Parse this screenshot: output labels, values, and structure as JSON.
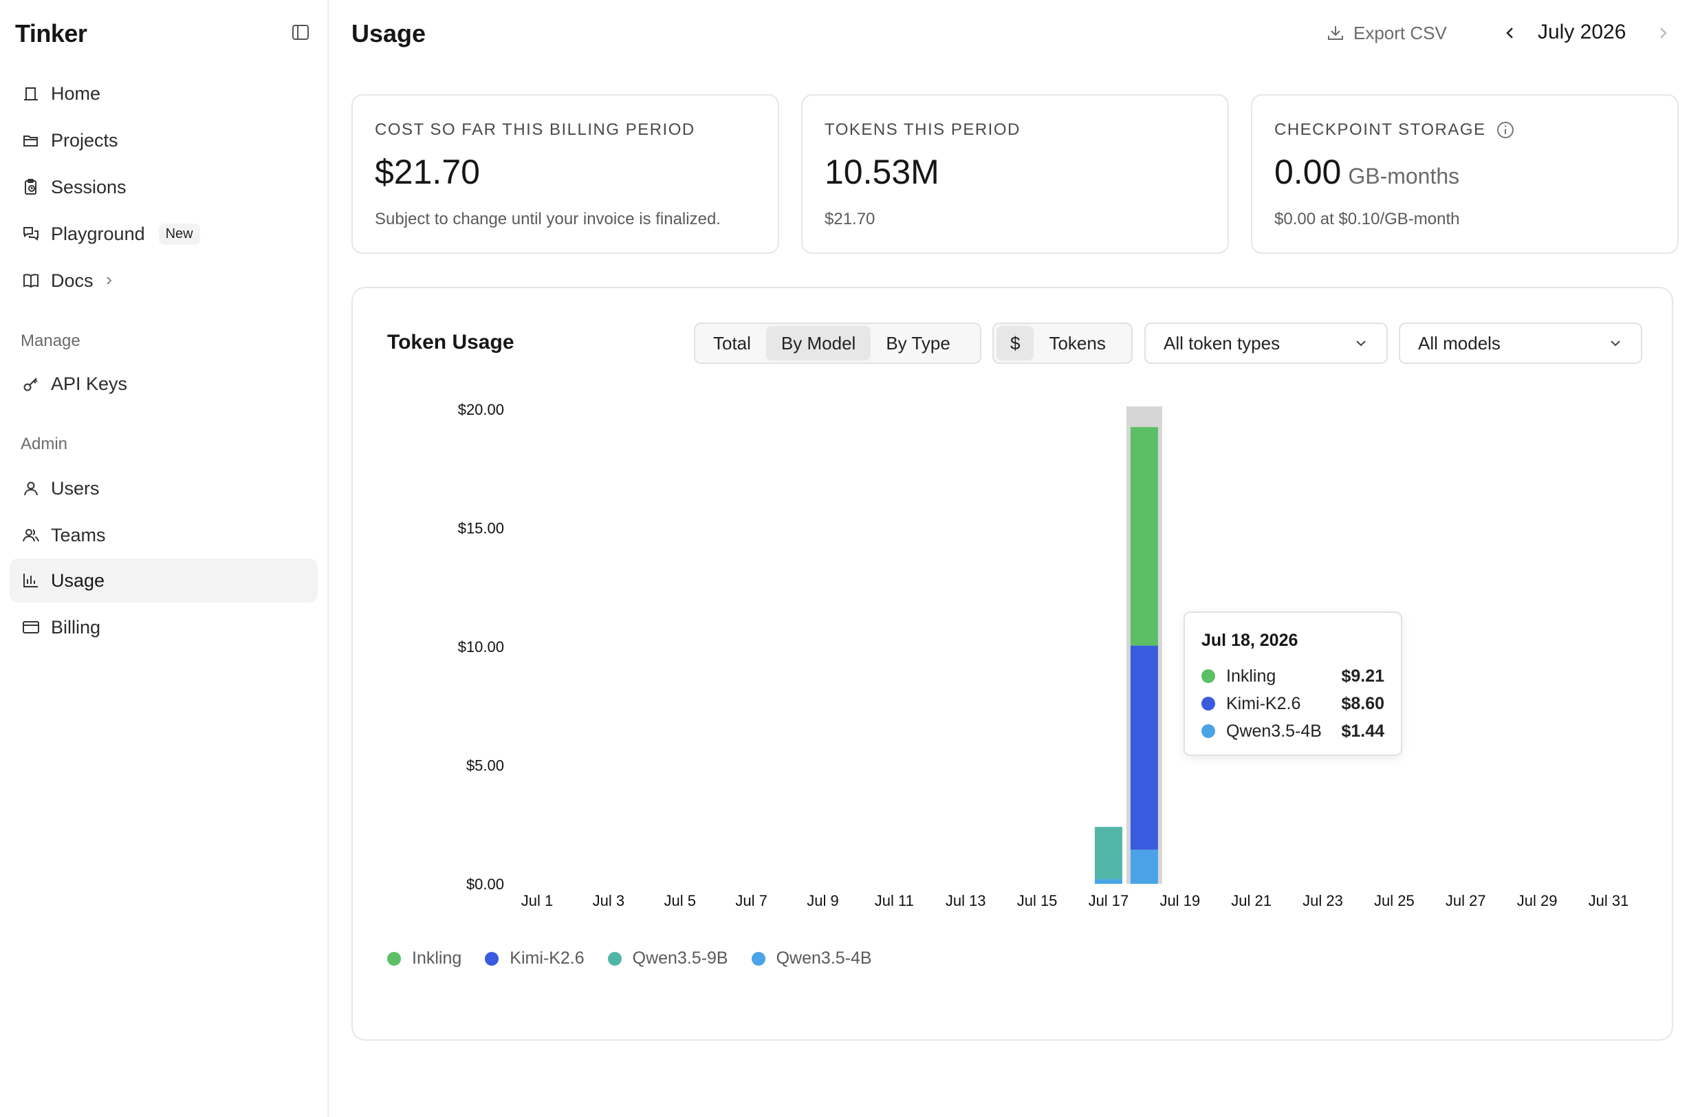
{
  "app": {
    "name": "Tinker"
  },
  "sidebar": {
    "items": [
      {
        "id": "home",
        "label": "Home",
        "icon": "home-icon"
      },
      {
        "id": "projects",
        "label": "Projects",
        "icon": "folder-icon"
      },
      {
        "id": "sessions",
        "label": "Sessions",
        "icon": "clipboard-clock-icon"
      },
      {
        "id": "playground",
        "label": "Playground",
        "icon": "chat-bubbles-icon",
        "badge": "New"
      },
      {
        "id": "docs",
        "label": "Docs",
        "icon": "book-open-icon"
      }
    ],
    "manage_label": "Manage",
    "manage_items": [
      {
        "id": "api-keys",
        "label": "API Keys",
        "icon": "key-icon"
      }
    ],
    "admin_label": "Admin",
    "admin_items": [
      {
        "id": "users",
        "label": "Users",
        "icon": "user-icon"
      },
      {
        "id": "teams",
        "label": "Teams",
        "icon": "users-icon"
      },
      {
        "id": "usage",
        "label": "Usage",
        "icon": "bar-chart-icon",
        "active": true
      },
      {
        "id": "billing",
        "label": "Billing",
        "icon": "credit-card-icon"
      }
    ]
  },
  "header": {
    "title": "Usage",
    "export_label": "Export CSV",
    "month": "July 2026"
  },
  "cards": [
    {
      "label": "COST SO FAR THIS BILLING PERIOD",
      "value": "$21.70",
      "sub": "Subject to change until your invoice is finalized."
    },
    {
      "label": "TOKENS THIS PERIOD",
      "value": "10.53M",
      "sub": "$21.70"
    },
    {
      "label": "CHECKPOINT STORAGE",
      "value": "0.00",
      "unit": "GB-months",
      "sub": "$0.00 at $0.10/GB-month"
    }
  ],
  "panel": {
    "title": "Token Usage",
    "view_tabs": [
      "Total",
      "By Model",
      "By Type"
    ],
    "view_selected": "By Model",
    "metric_tabs": [
      "$",
      "Tokens"
    ],
    "metric_selected": "$",
    "token_type_filter": "All token types",
    "model_filter": "All models"
  },
  "colors": {
    "Inkling": "#5cbf66",
    "Kimi-K2.6": "#3a5bde",
    "Qwen3.5-9B": "#52b6a6",
    "Qwen3.5-4B": "#4aa3e6",
    "hover_band": "#d6d6d6"
  },
  "chart_data": {
    "type": "bar",
    "stacked": true,
    "y_tick_labels": [
      "$0.00",
      "$5.00",
      "$10.00",
      "$15.00",
      "$20.00"
    ],
    "y_ticks": [
      0,
      5,
      10,
      15,
      20
    ],
    "ylim": [
      0,
      20
    ],
    "x_tick_labels": [
      "Jul 1",
      "Jul 3",
      "Jul 5",
      "Jul 7",
      "Jul 9",
      "Jul 11",
      "Jul 13",
      "Jul 15",
      "Jul 17",
      "Jul 19",
      "Jul 21",
      "Jul 23",
      "Jul 25",
      "Jul 27",
      "Jul 29",
      "Jul 31"
    ],
    "days": [
      1,
      2,
      3,
      4,
      5,
      6,
      7,
      8,
      9,
      10,
      11,
      12,
      13,
      14,
      15,
      16,
      17,
      18,
      19,
      20,
      21,
      22,
      23,
      24,
      25,
      26,
      27,
      28,
      29,
      30,
      31
    ],
    "series": [
      {
        "name": "Qwen3.5-4B",
        "values": [
          0,
          0,
          0,
          0,
          0,
          0,
          0,
          0,
          0,
          0,
          0,
          0,
          0,
          0,
          0,
          0,
          0.2,
          1.44,
          0,
          0,
          0,
          0,
          0,
          0,
          0,
          0,
          0,
          0,
          0,
          0,
          0
        ]
      },
      {
        "name": "Qwen3.5-9B",
        "values": [
          0,
          0,
          0,
          0,
          0,
          0,
          0,
          0,
          0,
          0,
          0,
          0,
          0,
          0,
          0,
          0,
          2.2,
          0,
          0,
          0,
          0,
          0,
          0,
          0,
          0,
          0,
          0,
          0,
          0,
          0,
          0
        ]
      },
      {
        "name": "Kimi-K2.6",
        "values": [
          0,
          0,
          0,
          0,
          0,
          0,
          0,
          0,
          0,
          0,
          0,
          0,
          0,
          0,
          0,
          0,
          0,
          8.6,
          0,
          0,
          0,
          0,
          0,
          0,
          0,
          0,
          0,
          0,
          0,
          0,
          0
        ]
      },
      {
        "name": "Inkling",
        "values": [
          0,
          0,
          0,
          0,
          0,
          0,
          0,
          0,
          0,
          0,
          0,
          0,
          0,
          0,
          0,
          0,
          0,
          9.21,
          0,
          0,
          0,
          0,
          0,
          0,
          0,
          0,
          0,
          0,
          0,
          0,
          0
        ]
      }
    ],
    "highlighted_day": 18,
    "legend": [
      "Inkling",
      "Kimi-K2.6",
      "Qwen3.5-9B",
      "Qwen3.5-4B"
    ],
    "legend_position": "bottom-left",
    "grid": false
  },
  "tooltip": {
    "date": "Jul 18, 2026",
    "rows": [
      {
        "name": "Inkling",
        "value": "$9.21"
      },
      {
        "name": "Kimi-K2.6",
        "value": "$8.60"
      },
      {
        "name": "Qwen3.5-4B",
        "value": "$1.44"
      }
    ]
  }
}
